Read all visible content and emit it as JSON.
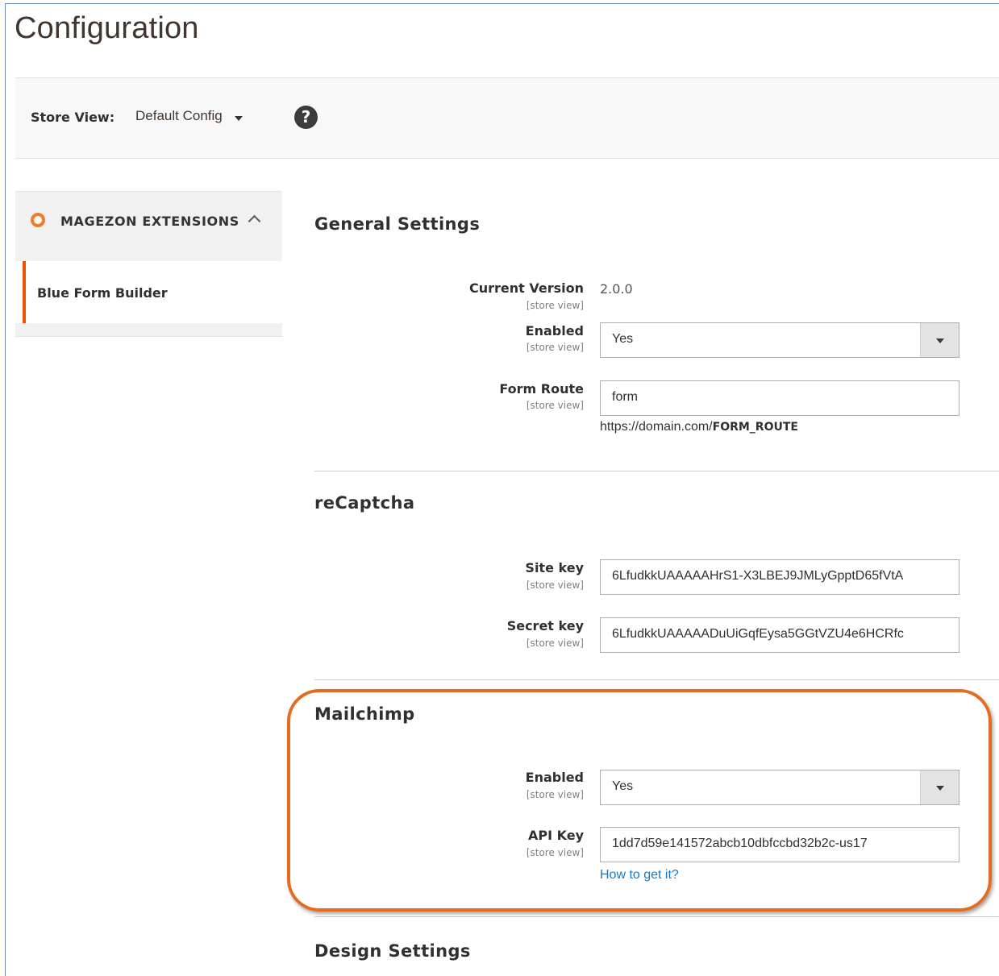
{
  "page": {
    "title": "Configuration"
  },
  "store_view": {
    "label": "Store View:",
    "value": "Default Config"
  },
  "sidebar": {
    "section_title": "MAGEZON EXTENSIONS",
    "items": [
      {
        "label": "Blue Form Builder"
      }
    ]
  },
  "scope_text": "[store view]",
  "general": {
    "title": "General Settings",
    "current_version": {
      "label": "Current Version",
      "value": "2.0.0"
    },
    "enabled": {
      "label": "Enabled",
      "value": "Yes"
    },
    "form_route": {
      "label": "Form Route",
      "value": "form",
      "note_prefix": "https://domain.com/",
      "note_bold": "FORM_ROUTE"
    }
  },
  "recaptcha": {
    "title": "reCaptcha",
    "site_key": {
      "label": "Site key",
      "value": "6LfudkkUAAAAAHrS1-X3LBEJ9JMLyGpptD65fVtA"
    },
    "secret_key": {
      "label": "Secret key",
      "value": "6LfudkkUAAAAADuUiGqfEysa5GGtVZU4e6HCRfc"
    }
  },
  "mailchimp": {
    "title": "Mailchimp",
    "enabled": {
      "label": "Enabled",
      "value": "Yes"
    },
    "api_key": {
      "label": "API Key",
      "value": "1dd7d59e141572abcb10dbfccbd32b2c-us17"
    },
    "help_link": "How to get it?"
  },
  "design": {
    "title": "Design Settings"
  },
  "colors": {
    "accent": "#eb5202",
    "highlight": "#e46c22",
    "link": "#1979c3"
  }
}
